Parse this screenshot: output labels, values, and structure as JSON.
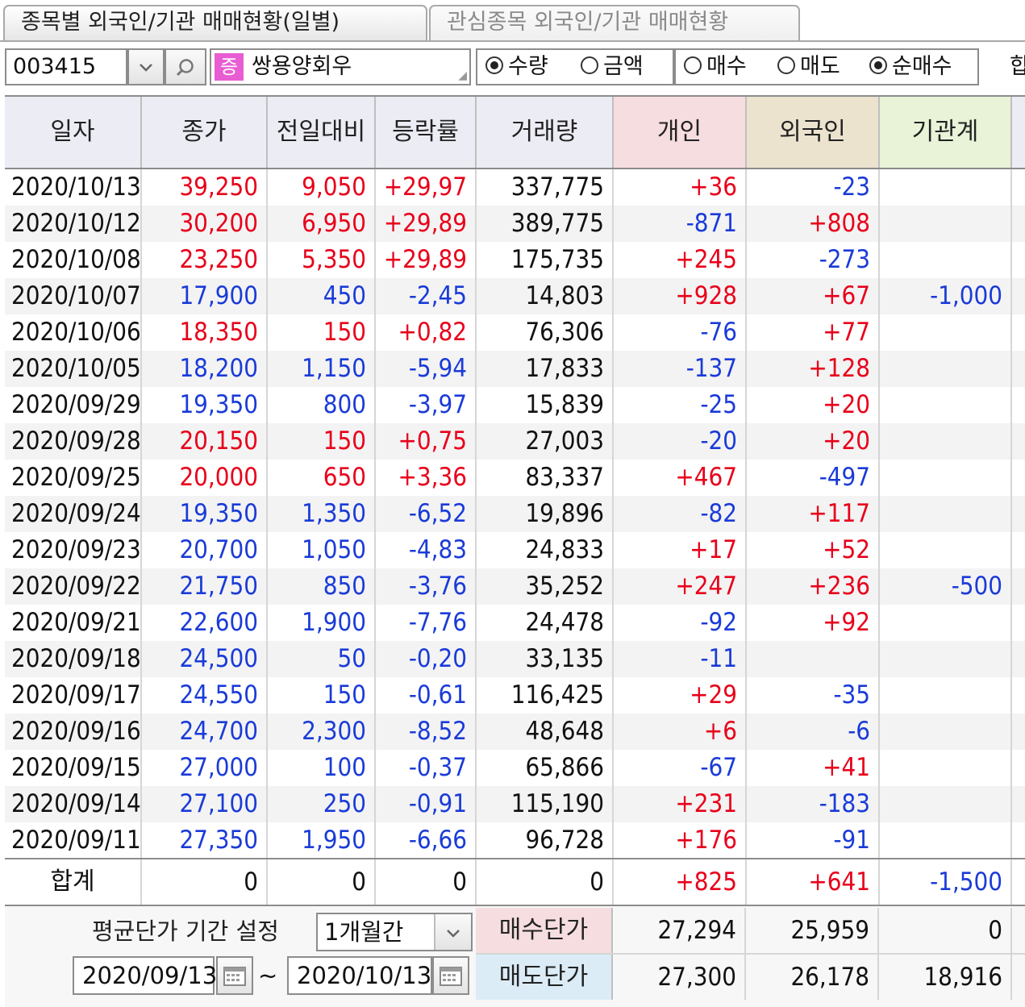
{
  "tabs": [
    {
      "label": "종목별 외국인/기관 매매현황(일별)"
    },
    {
      "label": "관심종목 외국인/기관 매매현황"
    }
  ],
  "toolbar": {
    "code": "003415",
    "badge": "증",
    "stock_name": "쌍용양회우",
    "unit_options": [
      {
        "label": "수량",
        "selected": true
      },
      {
        "label": "금액",
        "selected": false
      }
    ],
    "trade_options": [
      {
        "label": "매수",
        "selected": false
      },
      {
        "label": "매도",
        "selected": false
      },
      {
        "label": "순매수",
        "selected": true
      }
    ],
    "cut_label": "합"
  },
  "columns": [
    "일자",
    "종가",
    "전일대비",
    "등락률",
    "거래량",
    "개인",
    "외국인",
    "기관계"
  ],
  "colors": {
    "up": "#e8001a",
    "down": "#1a3bd8"
  },
  "rows": [
    {
      "date": "2020/10/13",
      "close": "39,250",
      "change": "9,050",
      "rate": "+29,97",
      "volume": "337,775",
      "individual": "+36",
      "foreign": "-23",
      "institution": "",
      "dir": "up"
    },
    {
      "date": "2020/10/12",
      "close": "30,200",
      "change": "6,950",
      "rate": "+29,89",
      "volume": "389,775",
      "individual": "-871",
      "foreign": "+808",
      "institution": "",
      "dir": "up"
    },
    {
      "date": "2020/10/08",
      "close": "23,250",
      "change": "5,350",
      "rate": "+29,89",
      "volume": "175,735",
      "individual": "+245",
      "foreign": "-273",
      "institution": "",
      "dir": "up"
    },
    {
      "date": "2020/10/07",
      "close": "17,900",
      "change": "450",
      "rate": "-2,45",
      "volume": "14,803",
      "individual": "+928",
      "foreign": "+67",
      "institution": "-1,000",
      "dir": "down"
    },
    {
      "date": "2020/10/06",
      "close": "18,350",
      "change": "150",
      "rate": "+0,82",
      "volume": "76,306",
      "individual": "-76",
      "foreign": "+77",
      "institution": "",
      "dir": "up"
    },
    {
      "date": "2020/10/05",
      "close": "18,200",
      "change": "1,150",
      "rate": "-5,94",
      "volume": "17,833",
      "individual": "-137",
      "foreign": "+128",
      "institution": "",
      "dir": "down"
    },
    {
      "date": "2020/09/29",
      "close": "19,350",
      "change": "800",
      "rate": "-3,97",
      "volume": "15,839",
      "individual": "-25",
      "foreign": "+20",
      "institution": "",
      "dir": "down"
    },
    {
      "date": "2020/09/28",
      "close": "20,150",
      "change": "150",
      "rate": "+0,75",
      "volume": "27,003",
      "individual": "-20",
      "foreign": "+20",
      "institution": "",
      "dir": "up"
    },
    {
      "date": "2020/09/25",
      "close": "20,000",
      "change": "650",
      "rate": "+3,36",
      "volume": "83,337",
      "individual": "+467",
      "foreign": "-497",
      "institution": "",
      "dir": "up"
    },
    {
      "date": "2020/09/24",
      "close": "19,350",
      "change": "1,350",
      "rate": "-6,52",
      "volume": "19,896",
      "individual": "-82",
      "foreign": "+117",
      "institution": "",
      "dir": "down"
    },
    {
      "date": "2020/09/23",
      "close": "20,700",
      "change": "1,050",
      "rate": "-4,83",
      "volume": "24,833",
      "individual": "+17",
      "foreign": "+52",
      "institution": "",
      "dir": "down"
    },
    {
      "date": "2020/09/22",
      "close": "21,750",
      "change": "850",
      "rate": "-3,76",
      "volume": "35,252",
      "individual": "+247",
      "foreign": "+236",
      "institution": "-500",
      "dir": "down"
    },
    {
      "date": "2020/09/21",
      "close": "22,600",
      "change": "1,900",
      "rate": "-7,76",
      "volume": "24,478",
      "individual": "-92",
      "foreign": "+92",
      "institution": "",
      "dir": "down"
    },
    {
      "date": "2020/09/18",
      "close": "24,500",
      "change": "50",
      "rate": "-0,20",
      "volume": "33,135",
      "individual": "-11",
      "foreign": "",
      "institution": "",
      "dir": "down"
    },
    {
      "date": "2020/09/17",
      "close": "24,550",
      "change": "150",
      "rate": "-0,61",
      "volume": "116,425",
      "individual": "+29",
      "foreign": "-35",
      "institution": "",
      "dir": "down"
    },
    {
      "date": "2020/09/16",
      "close": "24,700",
      "change": "2,300",
      "rate": "-8,52",
      "volume": "48,648",
      "individual": "+6",
      "foreign": "-6",
      "institution": "",
      "dir": "down"
    },
    {
      "date": "2020/09/15",
      "close": "27,000",
      "change": "100",
      "rate": "-0,37",
      "volume": "65,866",
      "individual": "-67",
      "foreign": "+41",
      "institution": "",
      "dir": "down"
    },
    {
      "date": "2020/09/14",
      "close": "27,100",
      "change": "250",
      "rate": "-0,91",
      "volume": "115,190",
      "individual": "+231",
      "foreign": "-183",
      "institution": "",
      "dir": "down"
    },
    {
      "date": "2020/09/11",
      "close": "27,350",
      "change": "1,950",
      "rate": "-6,66",
      "volume": "96,728",
      "individual": "+176",
      "foreign": "-91",
      "institution": "",
      "dir": "down"
    }
  ],
  "total": {
    "label": "합계",
    "close": "0",
    "change": "0",
    "rate": "0",
    "volume": "0",
    "individual": "+825",
    "foreign": "+641",
    "institution": "-1,500"
  },
  "avg_price": {
    "label": "평균단가 기간 설정",
    "period": "1개월간",
    "start_date": "2020/09/13",
    "tilde": "~",
    "end_date": "2020/10/13",
    "buy_label": "매수단가",
    "sell_label": "매도단가",
    "buy": {
      "individual": "27,294",
      "foreign": "25,959",
      "institution": "0"
    },
    "sell": {
      "individual": "27,300",
      "foreign": "26,178",
      "institution": "18,916"
    }
  }
}
